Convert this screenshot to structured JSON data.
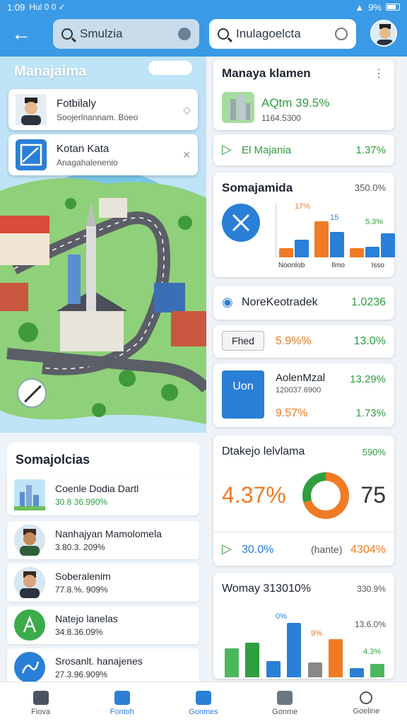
{
  "statusbar": {
    "time": "1:09",
    "left_icons": "Hul 0 0 ✓",
    "battery": "9%"
  },
  "header": {
    "back_icon": "arrow-left-icon",
    "search1": "Smulzia",
    "search2": "Inulagoelcta"
  },
  "map": {
    "title": "Manajaima",
    "cards": [
      {
        "title": "Fotbilaly",
        "subtitle": "Soojerlnannam. Boeo",
        "tail": "◇"
      },
      {
        "title": "Kotan Kata",
        "subtitle": "Anagahalenenio",
        "tail": "✕"
      }
    ]
  },
  "list": {
    "title": "Somajolcias",
    "items": [
      {
        "title": "Coenle Dodia Dartl",
        "value": "30.8 36.990%",
        "value_color": "green",
        "icon": "city-icon"
      },
      {
        "title": "Nanhajyan Mamolomela",
        "value": "3.80.3. 209%",
        "icon": "person-avatar-icon"
      },
      {
        "title": "Soberalenim",
        "value": "77.8.%. 909%",
        "icon": "person-avatar-icon"
      },
      {
        "title": "Natejo lanelas",
        "value": "34.8.36.09%",
        "icon": "tree-icon"
      },
      {
        "title": "Srosanlt. hanajenes",
        "value": "27.3.96.909%",
        "icon": "map-icon"
      }
    ]
  },
  "cards": {
    "summary": {
      "title": "Manaya klamen",
      "name": "AQtm 39.5%",
      "sub": "1164.5300",
      "row_label": "El Majania",
      "row_value": "1.37%"
    },
    "chart1": {
      "title": "Somajamida",
      "corner": "350.0%"
    },
    "stat1": {
      "label": "NoreKeotradek",
      "value": "1.0236"
    },
    "stat2": {
      "tag": "Fhed",
      "mid": "5.9%%",
      "value": "13.0%"
    },
    "stat3": {
      "icon_text": "Uon",
      "title": "AolenMzal",
      "sub": "120037.6900",
      "mid": "9.57%",
      "value1": "13.29%",
      "value2": "1.73%"
    },
    "donut": {
      "title": "Dtakejo lelvlama",
      "corner": "590%",
      "big": "4.37%",
      "right": "75",
      "foot_left": "30.0%",
      "foot_mid": "(hante)",
      "foot_right": "4304%"
    },
    "chart2": {
      "title": "Womay 313010%",
      "corner": "330.9%",
      "side": "13.6.0%"
    }
  },
  "chart_data": [
    {
      "type": "bar",
      "title": "Somajamida",
      "categories": [
        "Noonlob",
        "Ilmo",
        "Isso"
      ],
      "series": [
        {
          "values": [
            1.5,
            6,
            1.5
          ]
        },
        {
          "values": [
            3,
            4.3,
            1.8
          ]
        },
        {
          "values": [
            0,
            0,
            4
          ]
        }
      ],
      "colors": [
        "#f07b24",
        "#2a7fd6",
        "#2a7fd6"
      ],
      "data_labels": [
        "17%",
        "15",
        "5.3%"
      ],
      "ylim": [
        0,
        9
      ]
    },
    {
      "type": "pie",
      "title": "Dtakejo lelvlama",
      "series": [
        {
          "name": "",
          "values": [
            70,
            30
          ]
        }
      ],
      "colors": [
        "#f07b24",
        "#2e9e3e"
      ]
    },
    {
      "type": "bar",
      "title": "Womay 313010%",
      "values": [
        4,
        4.8,
        2.3,
        7.5,
        2.1,
        5.3,
        1.3,
        1.9
      ],
      "colors": [
        "#4cb85e",
        "#2e9e3e",
        "#2a7fd6",
        "#2a7fd6",
        "#888",
        "#f07b24",
        "#2a7fd6",
        "#4cb85e"
      ],
      "data_labels": [
        "0%",
        "9%",
        "4.3%"
      ],
      "ylim": [
        0,
        9
      ]
    }
  ],
  "bottom_nav": [
    {
      "label": "Fiova",
      "icon": "home-icon",
      "active": false
    },
    {
      "label": "Fontoh",
      "icon": "tag-icon",
      "active": true
    },
    {
      "label": "Gonmes",
      "icon": "building-icon",
      "active": true
    },
    {
      "label": "Gonme",
      "icon": "bag-icon",
      "active": false
    },
    {
      "label": "Goeline",
      "icon": "profile-icon",
      "active": false
    }
  ]
}
